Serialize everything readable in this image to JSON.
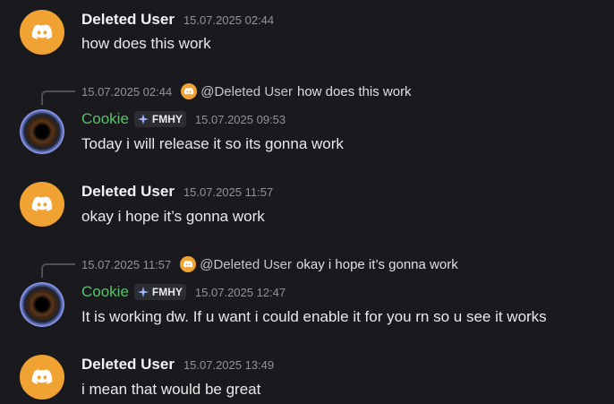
{
  "colors": {
    "background": "#1a1a1e",
    "discord_avatar_bg": "#f0a232",
    "cookie_name": "#57c26b",
    "timestamp": "#8f939b"
  },
  "messages": [
    {
      "author": "Deleted User",
      "avatar": "discord-default-avatar",
      "time": "15.07.2025 02:44",
      "text": "how does this work"
    },
    {
      "reply": {
        "time": "15.07.2025 02:44",
        "avatar": "discord-default-avatar",
        "author": "@Deleted User",
        "text": "how does this work"
      },
      "author": "Cookie",
      "avatar": "eye-avatar",
      "tag": "FMHY",
      "time": "15.07.2025 09:53",
      "text": "Today i will release it so its gonna work"
    },
    {
      "author": "Deleted User",
      "avatar": "discord-default-avatar",
      "time": "15.07.2025 11:57",
      "text": "okay i hope it’s gonna work"
    },
    {
      "reply": {
        "time": "15.07.2025 11:57",
        "avatar": "discord-default-avatar",
        "author": "@Deleted User",
        "text": "okay i hope it’s gonna work"
      },
      "author": "Cookie",
      "avatar": "eye-avatar",
      "tag": "FMHY",
      "time": "15.07.2025 12:47",
      "text": "It is working dw. If u want i could enable it for you rn so u see it works"
    },
    {
      "author": "Deleted User",
      "avatar": "discord-default-avatar",
      "time": "15.07.2025 13:49",
      "text": "i mean that would be great"
    }
  ]
}
